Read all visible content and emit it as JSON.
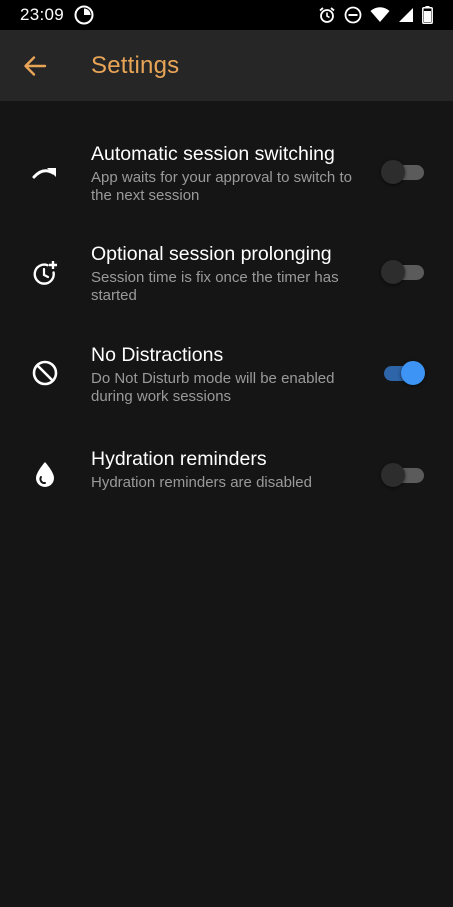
{
  "status_bar": {
    "time": "23:09",
    "icons": [
      "timer-app-icon",
      "alarm-icon",
      "do-not-disturb-icon",
      "wifi-icon",
      "signal-icon",
      "battery-icon"
    ]
  },
  "app_bar": {
    "title": "Settings",
    "back_icon": "arrow-left-icon"
  },
  "colors": {
    "accent": "#e8a557",
    "toggle_on": "#3d94f5",
    "background": "#151515",
    "app_bar": "#262626"
  },
  "settings": [
    {
      "icon": "redo-arrow-icon",
      "title": "Automatic session switching",
      "description": "App waits for your approval to switch to the next session",
      "enabled": false
    },
    {
      "icon": "clock-plus-icon",
      "title": "Optional session prolonging",
      "description": "Session time is fix once the timer has started",
      "enabled": false
    },
    {
      "icon": "block-icon",
      "title": "No Distractions",
      "description": "Do Not Disturb mode will be enabled during work sessions",
      "enabled": true
    },
    {
      "icon": "water-drop-icon",
      "title": "Hydration reminders",
      "description": "Hydration reminders are disabled",
      "enabled": false
    }
  ]
}
